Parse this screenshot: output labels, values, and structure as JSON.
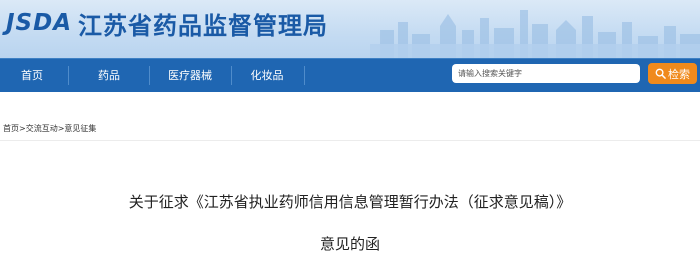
{
  "header": {
    "logo_abbr": "JSDA",
    "site_name": "江苏省药品监督管理局"
  },
  "nav": {
    "items": [
      {
        "label": "首页"
      },
      {
        "label": "药品"
      },
      {
        "label": "医疗器械"
      },
      {
        "label": "化妆品"
      }
    ]
  },
  "search": {
    "placeholder": "请输入搜索关键字",
    "button_label": "检索"
  },
  "breadcrumb": {
    "home": "首页",
    "sep1": ">",
    "section": "交流互动",
    "sep2": ">",
    "current": "意见征集"
  },
  "article": {
    "title_line1": "关于征求《江苏省执业药师信用信息管理暂行办法（征求意见稿）》",
    "title_line2": "意见的函"
  },
  "colors": {
    "nav_bg": "#1f66b2",
    "brand_blue": "#1a5aa6",
    "search_button": "#f08a1c"
  }
}
